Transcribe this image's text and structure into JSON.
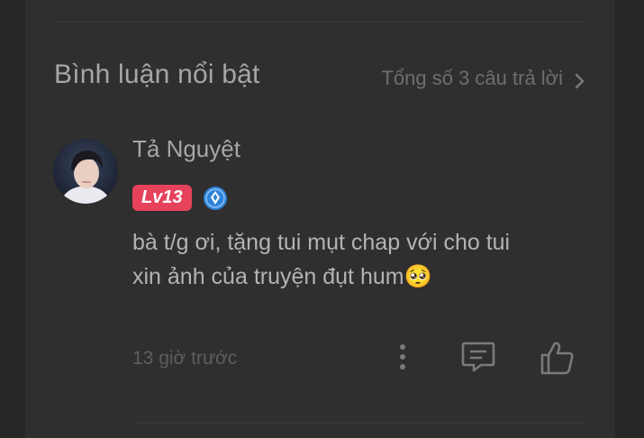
{
  "section": {
    "title": "Bình luận nổi bật",
    "total_replies": "Tổng số 3 câu trả lời"
  },
  "comment": {
    "author": "Tả Nguyệt",
    "level": "Lv13",
    "text_lines": [
      "bà t/g ơi, tặng tui mụt chap với cho tui",
      "xin ảnh của truyện đụt hum🥺"
    ],
    "time": "13 giờ trước"
  },
  "colors": {
    "background": "#262626",
    "panel": "#2f2f2f",
    "level_badge": "#e6425c",
    "vip_badge": "#2d83d8",
    "text_primary": "#a6a6a6",
    "text_muted": "#6e6e6e"
  },
  "icons": {
    "chevron": "chevron-right-icon",
    "vip": "diamond-badge-icon",
    "more": "more-vertical-icon",
    "reply": "comment-icon",
    "like": "thumbs-up-icon"
  }
}
